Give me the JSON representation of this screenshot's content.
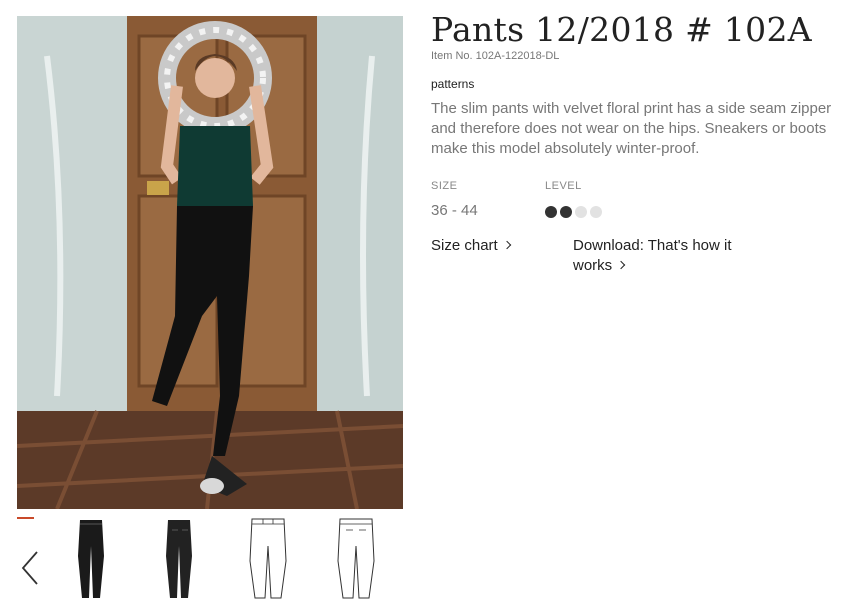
{
  "product": {
    "title": "Pants 12/2018 # 102A",
    "item_number": "Item No. 102A-122018-DL",
    "category_tag": "patterns",
    "description": "The slim pants with velvet floral print has a side seam zipper and therefore does not wear on the hips. Sneakers or boots make this model absolutely winter-proof."
  },
  "specs": {
    "size_label": "SIZE",
    "size_value": "36 - 44",
    "level_label": "LEVEL",
    "level_filled": 2,
    "level_total": 4
  },
  "links": {
    "size_chart": "Size chart",
    "download_line1": "Download: That's how it",
    "download_line2": "works"
  },
  "gallery": {
    "thumbnails": [
      "front-view",
      "back-view",
      "technical-drawing-front",
      "technical-drawing-back"
    ]
  },
  "colors": {
    "accent": "#c94a2a",
    "level_on": "#333333",
    "level_off": "#e2e2e2"
  }
}
